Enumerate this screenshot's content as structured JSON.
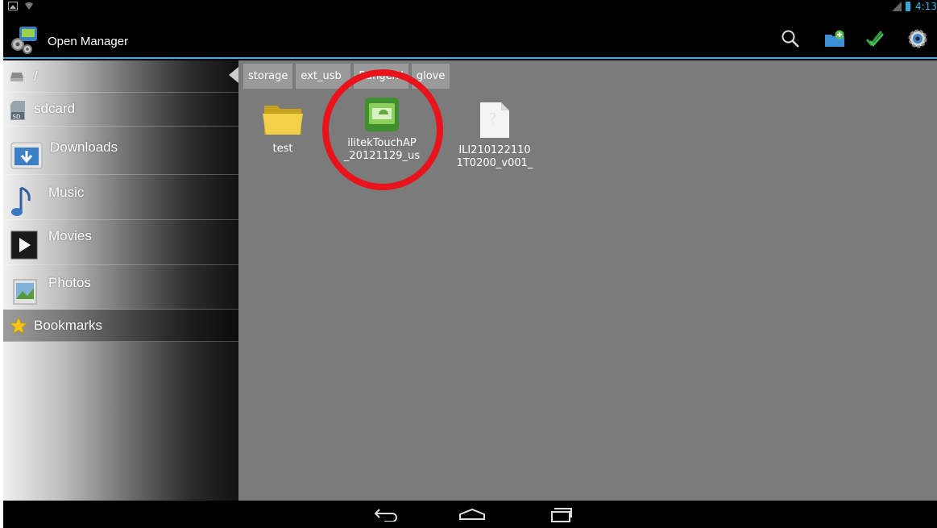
{
  "status_bar": {
    "time": "4:13",
    "icons": [
      "image-notification-icon",
      "wifi-icon",
      "signal-icon",
      "battery-icon"
    ]
  },
  "action_bar": {
    "title": "Open Manager",
    "actions": [
      "search-icon",
      "new-folder-icon",
      "multi-select-icon",
      "settings-icon"
    ]
  },
  "sidebar": {
    "items": [
      {
        "label": "/",
        "icon": "root-drive-icon"
      },
      {
        "label": "sdcard",
        "icon": "sd-card-icon"
      },
      {
        "label": "Downloads",
        "icon": "downloads-folder-icon"
      },
      {
        "label": "Music",
        "icon": "music-note-icon"
      },
      {
        "label": "Movies",
        "icon": "movies-play-icon"
      },
      {
        "label": "Photos",
        "icon": "photos-icon"
      },
      {
        "label": "Bookmarks",
        "icon": "star-icon"
      }
    ]
  },
  "breadcrumbs": [
    "storage",
    "ext_usb",
    "RangerX",
    "glove"
  ],
  "files": [
    {
      "name": "test",
      "type": "folder"
    },
    {
      "name": "ilitekTouchAP_20121129_us",
      "line1": "ilitekTouchAP",
      "line2": "_20121129_us",
      "type": "apk"
    },
    {
      "name": "ILI2101221101T0200_v001_",
      "line1": "ILI210122110",
      "line2": "1T0200_v001_",
      "type": "unknown"
    }
  ],
  "colors": {
    "accent": "#33b5e5",
    "highlight_ring": "#e8131b",
    "content_bg": "#7b7b7b"
  },
  "navigation_bar": [
    "back-icon",
    "home-icon",
    "recent-apps-icon"
  ]
}
